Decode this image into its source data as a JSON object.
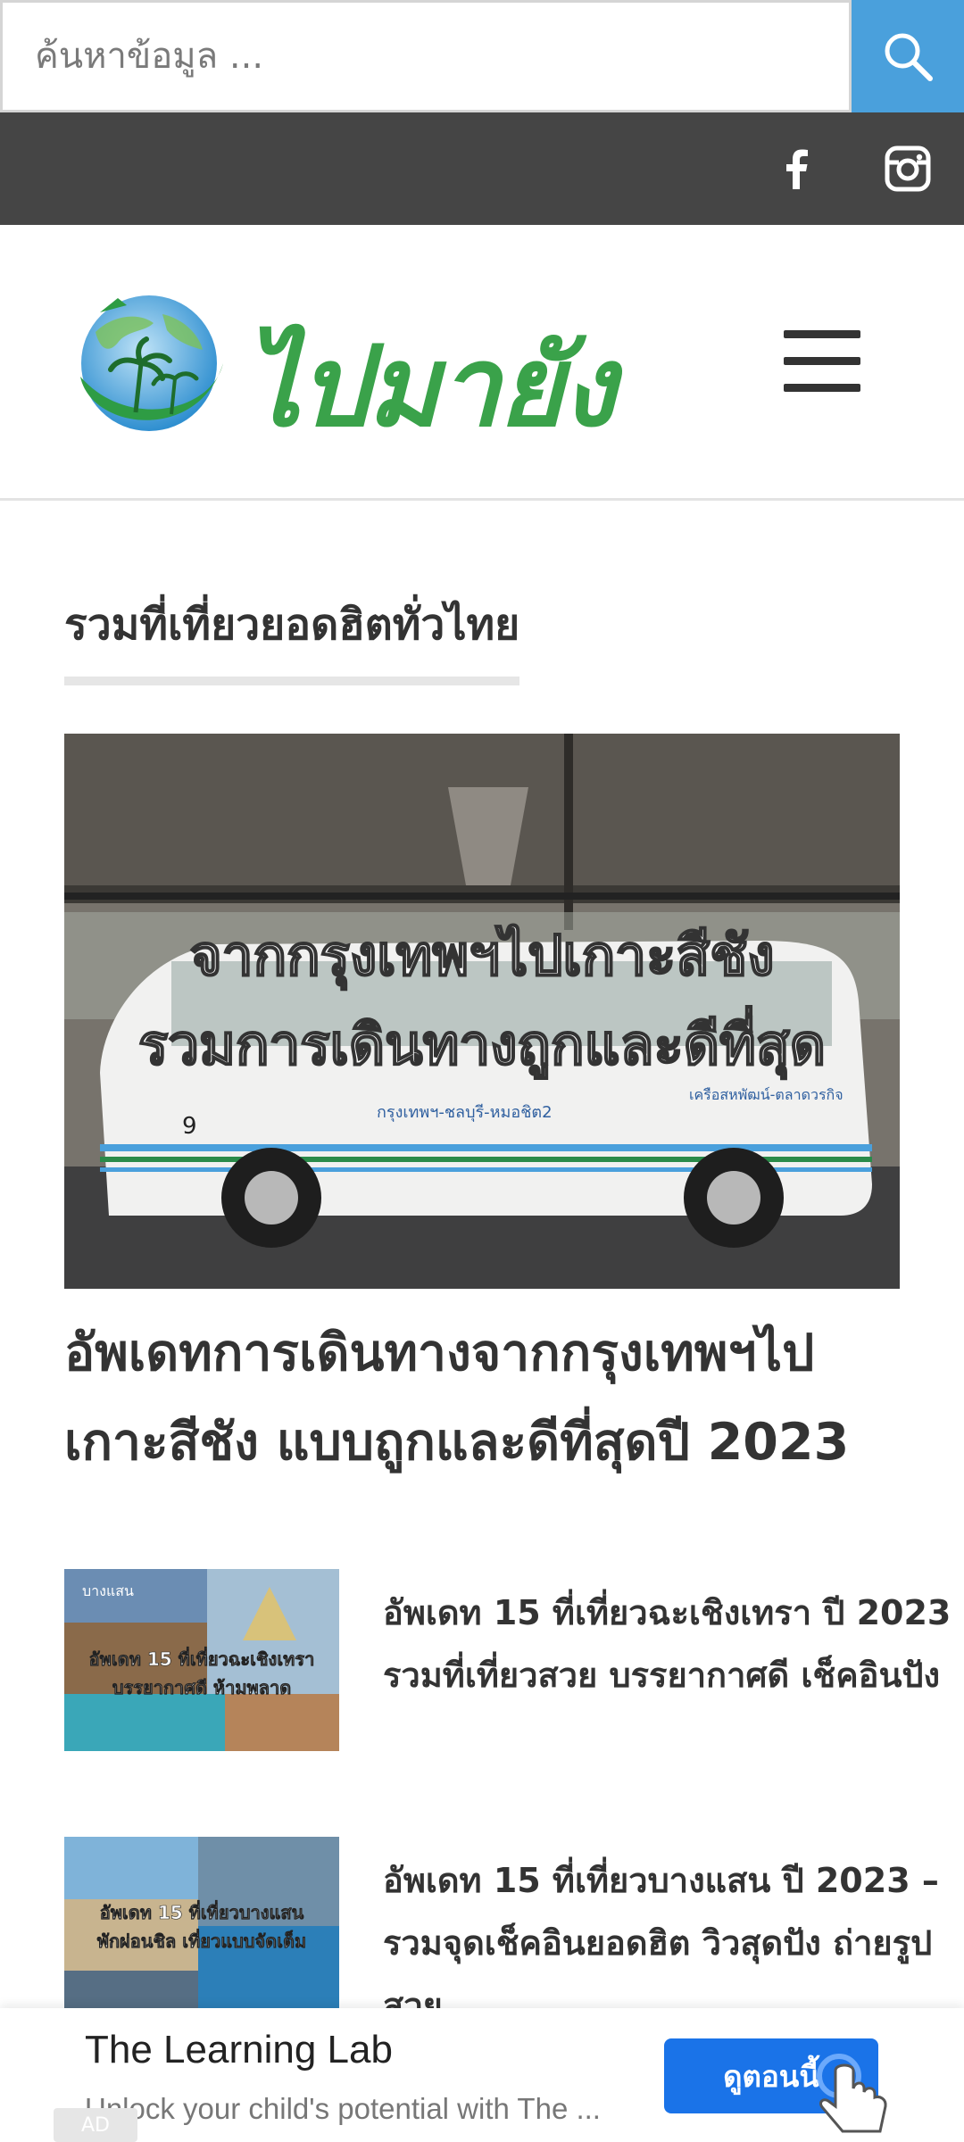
{
  "search": {
    "placeholder": "ค้นหาข้อมูล ..."
  },
  "icons": {
    "search": "search-icon",
    "facebook": "facebook-icon",
    "instagram": "instagram-icon",
    "menu": "hamburger-menu-icon"
  },
  "logo": {
    "text": "ไปมายัง"
  },
  "section": {
    "title": "รวมที่เที่ยวยอดฮิตทั่วไทย"
  },
  "featured": {
    "overlay_line1": "จากกรุงเทพฯไปเกาะสีชัง",
    "overlay_line2": "รวมการเดินทางถูกและดีที่สุด",
    "van_route": "กรุงเทพฯ-ชลบุรี-หมอชิต2",
    "van_route2": "เครือสหพัฒน์-ตลาดวรกิจ",
    "van_number": "9",
    "title_line1": "อัพเดทการเดินทางจากกรุงเทพฯไป",
    "title_line2": "เกาะสีชัง แบบถูกและดีที่สุดปี 2023"
  },
  "posts": [
    {
      "title_line1": "อัพเดท 15 ที่เที่ยวฉะเชิงเทรา ปี 2023 –",
      "title_line2": "รวมที่เที่ยวสวย บรรยากาศดี เช็คอินปัง",
      "thumb_tag": "บางแสน",
      "thumb_line1": "อัพเดท 15 ที่เที่ยวฉะเชิงเทรา",
      "thumb_line2": "บรรยากาศดี ห้ามพลาด"
    },
    {
      "title_line1": "อัพเดท 15 ที่เที่ยวบางแสน ปี 2023 –",
      "title_line2": "รวมจุดเช็คอินยอดฮิต วิวสุดปัง ถ่ายรูป",
      "title_line3": "สวย",
      "thumb_line1": "อัพเดท 15 ที่เที่ยวบางแสน",
      "thumb_line2": "พักผ่อนชิล เที่ยวแบบจัดเต็ม"
    }
  ],
  "ad": {
    "title": "The Learning Lab",
    "subtitle": "Unlock your child's potential with The ...",
    "cta": "ดูตอนนี้",
    "badge": "AD"
  },
  "colors": {
    "search_button": "#4aa0dc",
    "social_bar": "#454545",
    "logo_green": "#3aa24a",
    "ad_button": "#1a73e8"
  }
}
